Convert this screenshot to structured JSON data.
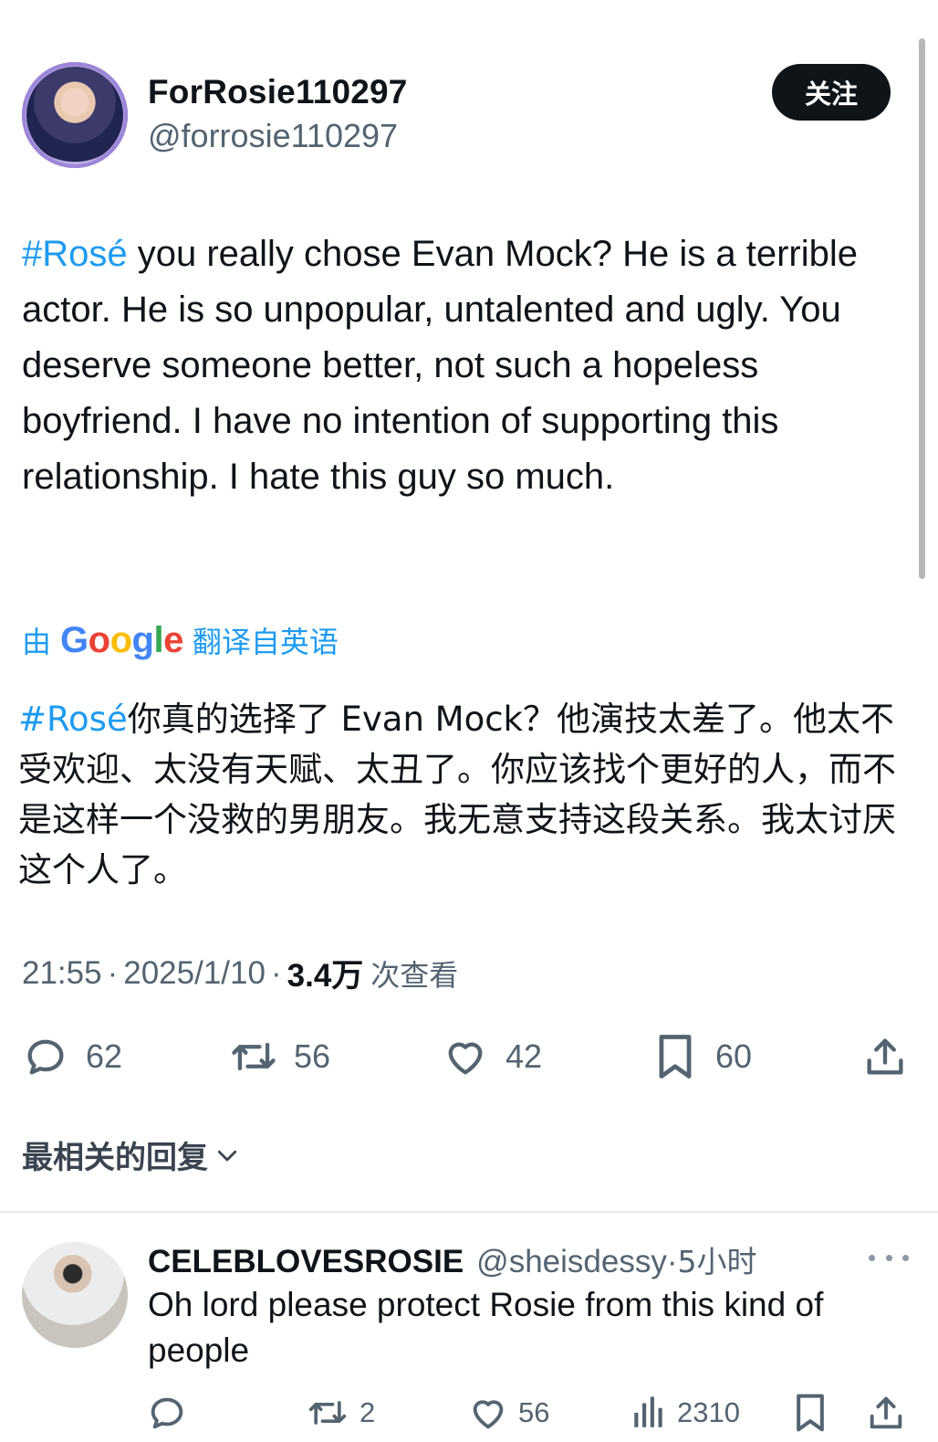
{
  "author": {
    "display_name": "ForRosie110297",
    "handle": "@forrosie110297",
    "follow_label": "关注"
  },
  "tweet": {
    "hashtag": "#Rosé",
    "text": " you really chose Evan Mock? He is a terrible actor. He is so unpopular, untalented and ugly.  You deserve someone better, not such a hopeless boyfriend. I have no intention of supporting this relationship. I hate this guy so much.",
    "translate": {
      "prefix": "由",
      "brand": "Google",
      "suffix": "翻译自英语"
    },
    "translated_hashtag": "#Rosé",
    "translated_text": "你真的选择了 Evan Mock？他演技太差了。他太不受欢迎、太没有天赋、太丑了。你应该找个更好的人，而不是这样一个没救的男朋友。我无意支持这段关系。我太讨厌这个人了。",
    "time": "21:55",
    "date": "2025/1/10",
    "views_count": "3.4万",
    "views_label": "次查看"
  },
  "actions": {
    "replies": "62",
    "retweets": "56",
    "likes": "42",
    "bookmarks": "60"
  },
  "sort_label": "最相关的回复",
  "reply": {
    "display_name": "CELEBLOVESROSIE",
    "handle": "@sheisdessy",
    "dot": "·",
    "time": "5小时",
    "text": "Oh lord please protect Rosie from this kind of people",
    "retweets": "2",
    "likes": "56",
    "views": "2310"
  },
  "colors": {
    "accent": "#1d9bf0",
    "text": "#0f1419",
    "secondary": "#536471",
    "follow_bg": "#0f1419"
  },
  "icons": [
    "comment-icon",
    "retweet-icon",
    "heart-icon",
    "bookmark-icon",
    "share-icon",
    "chevron-down-icon",
    "more-icon",
    "views-icon"
  ]
}
